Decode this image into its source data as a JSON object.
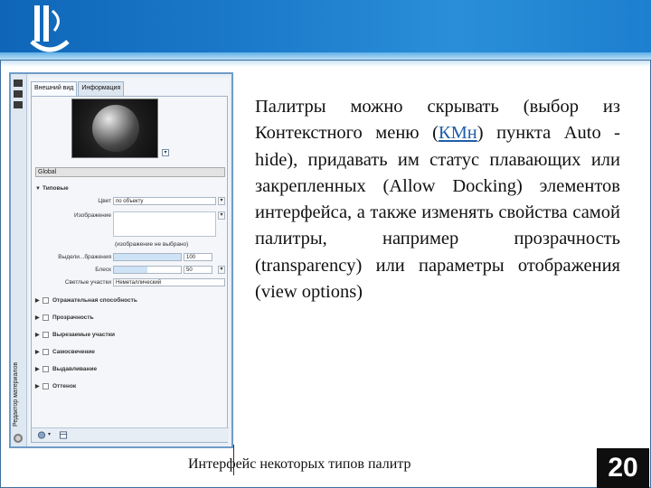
{
  "palette": {
    "side_title": "Редактор материалов",
    "tabs": [
      {
        "label": "Внешний вид"
      },
      {
        "label": "Информация"
      }
    ],
    "name_field": "Global",
    "section_main": "Типовые",
    "color_label": "Цвет",
    "color_value": "по объекту",
    "image_label": "Изображение",
    "image_placeholder": "(изображение не выбрано)",
    "highlight_label": "Выдели...бражения",
    "highlight_value": "100",
    "gloss_label": "Блеск",
    "gloss_value": "50",
    "light_areas_label": "Светлые участки",
    "light_areas_value": "Неметаллический",
    "sections": [
      {
        "label": "Отражательная способность"
      },
      {
        "label": "Прозрачность"
      },
      {
        "label": "Вырезаемые участки"
      },
      {
        "label": "Самосвечение"
      },
      {
        "label": "Выдавливание"
      },
      {
        "label": "Оттенок"
      }
    ]
  },
  "main_text": {
    "before_link": "Палитры можно скрывать (выбор из Контекстного меню (",
    "link": "КМн",
    "after_link": ") пункта Auto -hide), придавать им статус плавающих или закрепленных (Allow Docking) элементов интерфейса, а также изменять свойства самой палитры, например прозрачность (transparency) или параметры отображения (view options)"
  },
  "caption": "Интерфейс некоторых типов палитр",
  "page_number": "20",
  "icons": {
    "logo": "logo-icon",
    "settings": "gear-icon",
    "side_pin": "pin-icon"
  }
}
